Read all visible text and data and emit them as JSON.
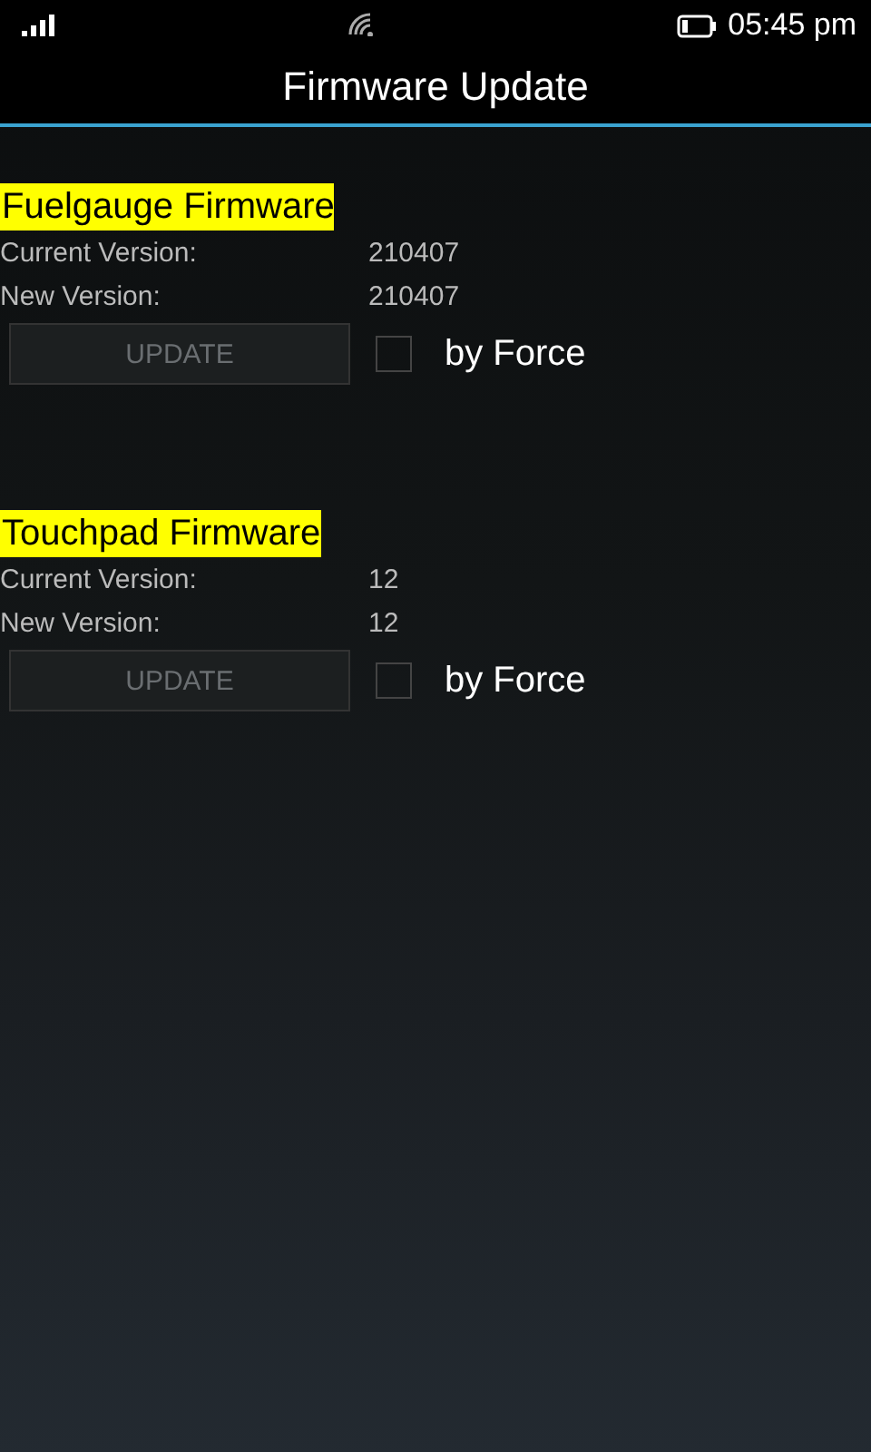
{
  "status_bar": {
    "time": "05:45 pm"
  },
  "title": "Firmware Update",
  "sections": [
    {
      "heading": "Fuelgauge Firmware",
      "rows": [
        {
          "label": "Current Version:",
          "value": "210407"
        },
        {
          "label": "New Version:",
          "value": "210407"
        }
      ],
      "button": {
        "label": "UPDATE",
        "disabled": true
      },
      "force": {
        "label": "by Force",
        "checked": false
      }
    },
    {
      "heading": "Touchpad Firmware",
      "rows": [
        {
          "label": "Current Version:",
          "value": "12"
        },
        {
          "label": "New Version:",
          "value": "12"
        }
      ],
      "button": {
        "label": "UPDATE",
        "disabled": true
      },
      "force": {
        "label": "by Force",
        "checked": false
      }
    }
  ]
}
